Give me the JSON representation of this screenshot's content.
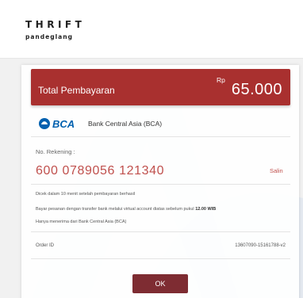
{
  "header": {
    "brand": "THRIFT",
    "brand_sub": "pandeglang"
  },
  "payment": {
    "total_label": "Total Pembayaran",
    "currency": "Rp",
    "amount": "65.000"
  },
  "bank": {
    "logo_text": "BCA",
    "name": "Bank Central Asia (BCA)"
  },
  "account": {
    "label": "No. Rekening :",
    "number": "600 0789056 121340",
    "copy_label": "Salin"
  },
  "info": {
    "line1": "Dicek dalam 10 menit setelah pembayaran berhasil",
    "line2_prefix": "Bayar pesanan dengan transfer bank melalui virtual account diatas sebelum pukul ",
    "line2_time": "12.00 WIB",
    "line3": "Hanya menerima dari Bank Central Asia (BCA)"
  },
  "order": {
    "label": "Order ID",
    "value": "13607090-15161788-v2"
  },
  "actions": {
    "ok_label": "OK"
  },
  "colors": {
    "total_bar": "#a9302f",
    "account_number": "#c0504d",
    "ok_button": "#7e2c32",
    "bca_blue": "#0060af"
  }
}
